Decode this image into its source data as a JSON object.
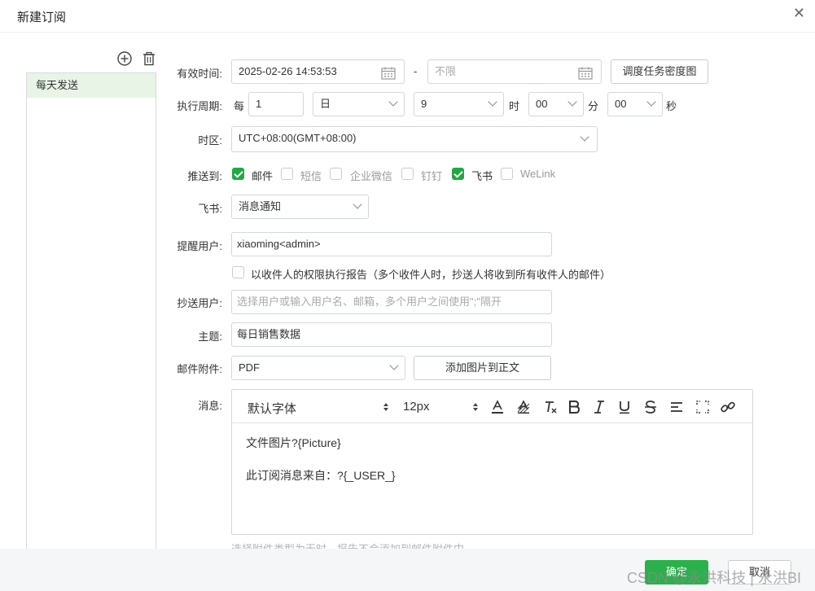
{
  "dialog": {
    "title": "新建订阅",
    "close_icon": "close-icon"
  },
  "list": {
    "add_icon": "add-circle-icon",
    "delete_icon": "trash-icon",
    "items": [
      "每天发送"
    ]
  },
  "form": {
    "valid_time": {
      "label": "有效时间:",
      "start": "2025-02-26 14:53:53",
      "separator": "-",
      "end_placeholder": "不限",
      "density_button": "调度任务密度图"
    },
    "cycle": {
      "label": "执行周期:",
      "every": "每",
      "count": "1",
      "unit": "日",
      "hour": "9",
      "hour_suffix": "时",
      "minute": "00",
      "minute_suffix": "分",
      "second": "00",
      "second_suffix": "秒"
    },
    "timezone": {
      "label": "时区:",
      "value": "UTC+08:00(GMT+08:00)"
    },
    "push_to": {
      "label": "推送到:",
      "options": [
        {
          "label": "邮件",
          "checked": true
        },
        {
          "label": "短信",
          "checked": false
        },
        {
          "label": "企业微信",
          "checked": false
        },
        {
          "label": "钉钉",
          "checked": false
        },
        {
          "label": "飞书",
          "checked": true
        },
        {
          "label": "WeLink",
          "checked": false
        }
      ]
    },
    "feishu": {
      "label": "飞书:",
      "value": "消息通知"
    },
    "remind_users": {
      "label": "提醒用户:",
      "value": "xiaoming<admin>",
      "permission_check_label": "以收件人的权限执行报告（多个收件人时，抄送人将收到所有收件人的邮件）"
    },
    "cc_users": {
      "label": "抄送用户:",
      "placeholder": "选择用户或输入用户名、邮箱，多个用户之间使用\";\"隔开"
    },
    "subject": {
      "label": "主题:",
      "value": "每日销售数据"
    },
    "attachment": {
      "label": "邮件附件:",
      "value": "PDF",
      "add_image_button": "添加图片到正文"
    },
    "message": {
      "label": "消息:",
      "font": "默认字体",
      "size": "12px",
      "lines": [
        "文件图片?{Picture}",
        "此订阅消息来自：?{_USER_}"
      ]
    },
    "hint": "选择附件类型为无时，报告不会添加到邮件附件中"
  },
  "footer": {
    "ok": "确定",
    "cancel": "取消",
    "watermark": "CSDN @永洪科技 | 永洪BI"
  },
  "colors": {
    "accent": "#2bb04c",
    "selected_bg": "#e8f4e5"
  }
}
